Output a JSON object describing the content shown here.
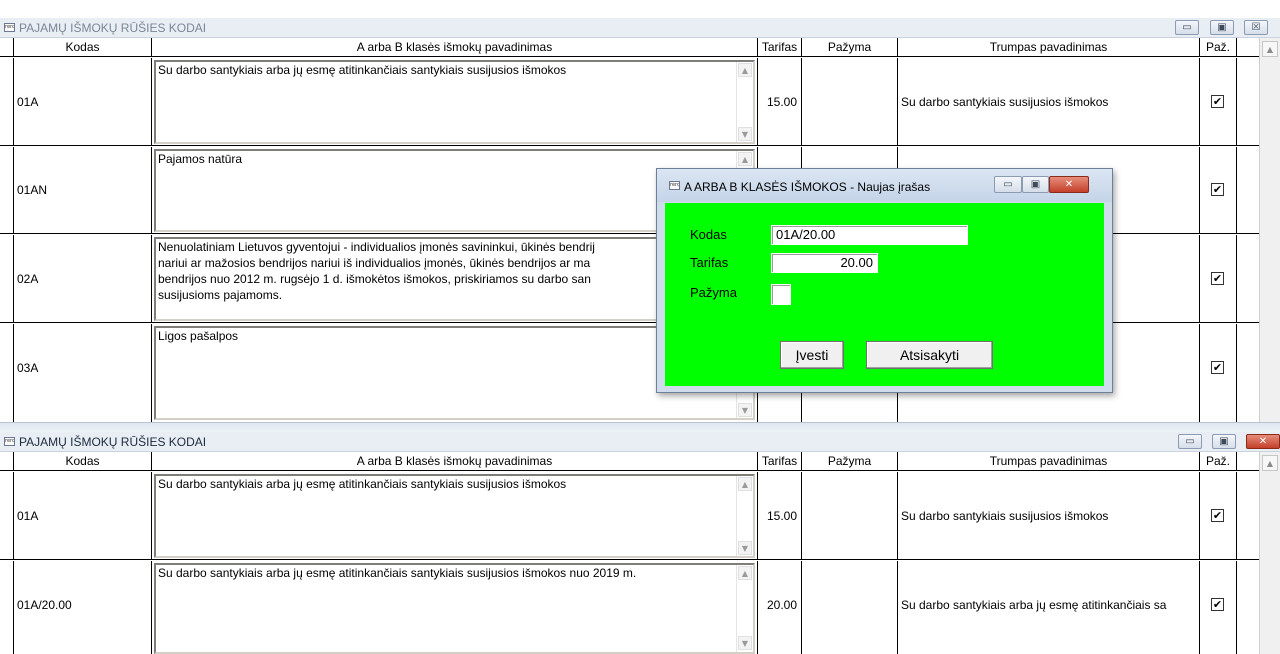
{
  "icon_badge": "rero",
  "window_top": {
    "title": "PAJAMŲ IŠMOKŲ RŪŠIES KODAI",
    "columns": [
      "Kodas",
      "A arba B klasės išmokų pavadinimas",
      "Tarifas",
      "Pažyma",
      "Trumpas pavadinimas",
      "Paž."
    ],
    "rows": [
      {
        "kodas": "01A",
        "pavadinimas": "Su darbo santykiais arba jų esmę atitinkančiais santykiais susijusios išmokos",
        "tarifas": "15.00",
        "pazyma": "",
        "trumpas": "Su darbo santykiais susijusios išmokos",
        "paz": "✔"
      },
      {
        "kodas": "01AN",
        "pavadinimas": "Pajamos natūra",
        "tarifas": "",
        "pazyma": "",
        "trumpas": "",
        "paz": "✔"
      },
      {
        "kodas": "02A",
        "pavadinimas": "Nenuolatiniam Lietuvos gyventojui - individualios įmonės savininkui, ūkinės bendrij\nnariui ar mažosios bendrijos nariui iš individualios įmonės, ūkinės bendrijos ar ma\nbendrijos nuo 2012 m. rugsėjo 1 d. išmokėtos išmokos, priskiriamos su darbo san\nsusijusioms pajamoms.",
        "tarifas": "",
        "pazyma": "",
        "trumpas": "",
        "paz": "✔"
      },
      {
        "kodas": "03A",
        "pavadinimas": "Ligos pašalpos",
        "tarifas": "",
        "pazyma": "",
        "trumpas": "",
        "paz": "✔"
      }
    ]
  },
  "window_bottom": {
    "title": "PAJAMŲ IŠMOKŲ RŪŠIES KODAI",
    "columns": [
      "Kodas",
      "A arba B klasės išmokų pavadinimas",
      "Tarifas",
      "Pažyma",
      "Trumpas pavadinimas",
      "Paž."
    ],
    "rows": [
      {
        "kodas": "01A",
        "pavadinimas": "Su darbo santykiais arba jų esmę atitinkančiais santykiais susijusios išmokos",
        "tarifas": "15.00",
        "pazyma": "",
        "trumpas": "Su darbo santykiais susijusios išmokos",
        "paz": "✔"
      },
      {
        "kodas": "01A/20.00",
        "pavadinimas": "Su darbo santykiais arba jų esmę atitinkančiais santykiais susijusios išmokos nuo 2019 m.",
        "tarifas": "20.00",
        "pazyma": "",
        "trumpas": "Su darbo santykiais arba jų esmę atitinkančiais sa",
        "paz": "✔"
      }
    ]
  },
  "dialog": {
    "title": "A ARBA B KLASĖS IŠMOKOS - Naujas įrašas",
    "kodas_label": "Kodas",
    "kodas_value": "01A/20.00",
    "tarifas_label": "Tarifas",
    "tarifas_value": "20.00",
    "pazyma_label": "Pažyma",
    "pazyma_value": "",
    "ivesti_label": "Įvesti",
    "atsisakyti_label": "Atsisakyti",
    "body_color": "#00ff00"
  },
  "glyphs": {
    "minimize": "▭",
    "maximize": "▣",
    "close": "✕",
    "close_inactive": "☒",
    "scroll_up": "▲",
    "scroll_down": "▼"
  }
}
